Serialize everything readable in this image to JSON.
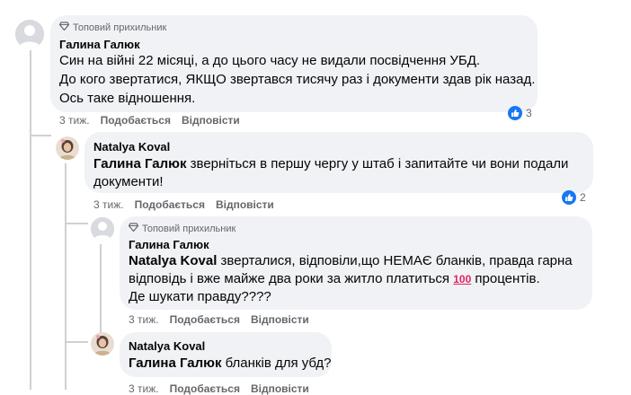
{
  "comments": [
    {
      "badge": "Топовий прихильник",
      "author": "Галина Галюк",
      "lines": [
        "Син на війні 22 місяці, а до цього часу не видали посвідчення УБД.",
        "До кого звертатися, ЯКЩО звертався тисячу раз і документи здав рік назад.",
        "Ось таке відношення."
      ],
      "time": "3 тиж.",
      "like_label": "Подобається",
      "reply_label": "Відповісти",
      "reaction_count": "3"
    },
    {
      "author": "Natalya Koval",
      "mention": "Галина Галюк",
      "line1_rest": " зверніться в першу чергу у штаб і запитайте чи вони подали",
      "line2": "документи!",
      "time": "3 тиж.",
      "like_label": "Подобається",
      "reply_label": "Відповісти",
      "reaction_count": "2"
    },
    {
      "badge": "Топовий прихильник",
      "author": "Галина Галюк",
      "mention": "Natalya Koval",
      "line1_rest": " зверталися, відповіли,що НЕМАЄ бланків, правда гарна",
      "line2_before": "відповідь і вже майже два роки за житло платиться ",
      "emoji": "100",
      "line2_after": " процентів.",
      "line3": "Де шукати правду????",
      "time": "3 тиж.",
      "like_label": "Подобається",
      "reply_label": "Відповісти"
    },
    {
      "author": "Natalya Koval",
      "mention": "Галина Галюк",
      "rest": " бланків для убд?",
      "time": "3 тиж.",
      "like_label": "Подобається",
      "reply_label": "Відповісти"
    }
  ],
  "colors": {
    "bubble": "#f0f2f5",
    "meta": "#65676b",
    "like": "#1877f2",
    "thread_line": "#ced0d4"
  },
  "icons": [
    "default-avatar-icon",
    "diamond-badge-icon",
    "like-reaction-icon",
    "profile-photo-avatar"
  ]
}
